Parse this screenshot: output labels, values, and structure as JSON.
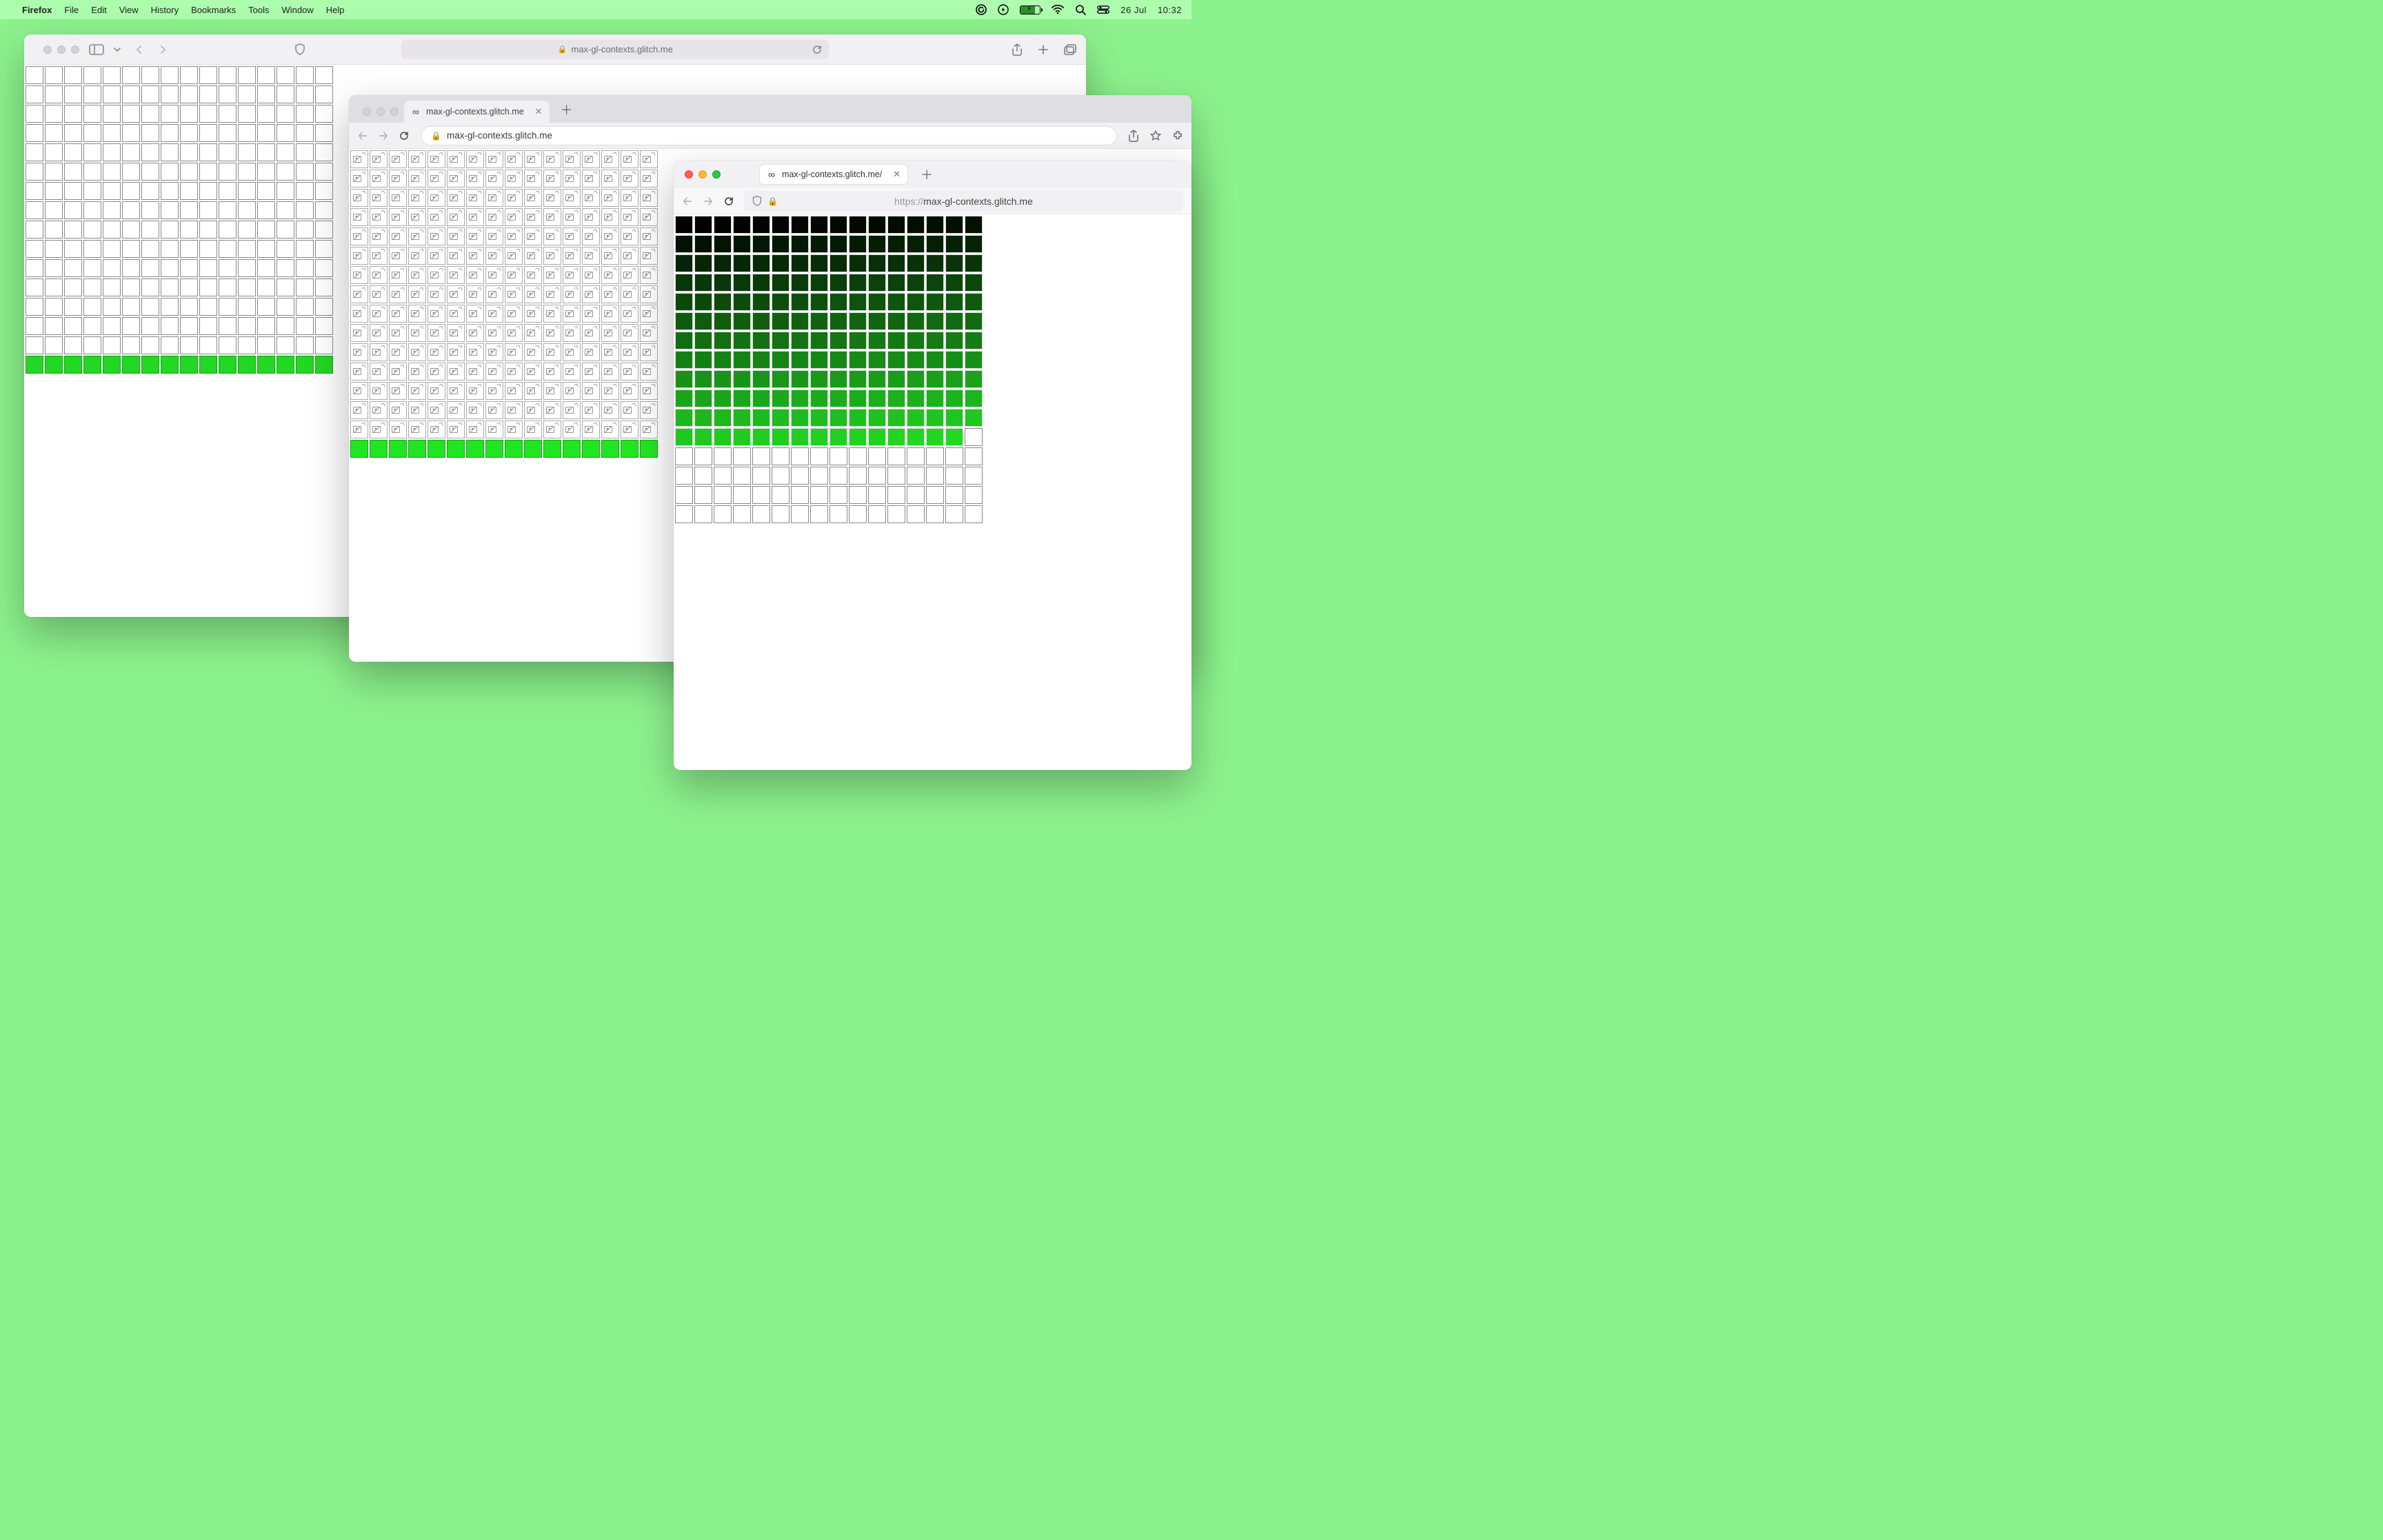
{
  "menubar": {
    "app": "Firefox",
    "items": [
      "File",
      "Edit",
      "View",
      "History",
      "Bookmarks",
      "Tools",
      "Window",
      "Help"
    ],
    "date": "26 Jul",
    "time": "10:32"
  },
  "safari": {
    "url_display": "max-gl-contexts.glitch.me",
    "grid": {
      "cols": 16,
      "total": 256,
      "filled_white": 240,
      "filled_accent": 16,
      "accent_row_index": 15,
      "accent_color": "#22d822"
    }
  },
  "chrome": {
    "tab_title": "max-gl-contexts.glitch.me",
    "url_display": "max-gl-contexts.glitch.me",
    "grid": {
      "cols": 16,
      "total": 256,
      "filled_broken": 240,
      "filled_accent": 16,
      "accent_row_index": 15,
      "accent_color": "#22e522"
    }
  },
  "firefox": {
    "tab_title": "max-gl-contexts.glitch.me/",
    "url_proto": "https://",
    "url_display": "max-gl-contexts.glitch.me",
    "grid": {
      "cols": 16,
      "total": 256,
      "filled_gradient": 191,
      "filled_white": 65,
      "gradient_start": "#000000",
      "gradient_end": "#22d822"
    }
  }
}
